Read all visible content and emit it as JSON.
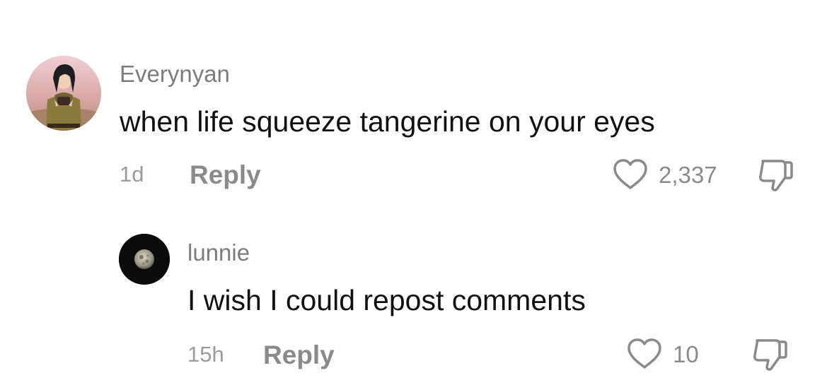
{
  "comments": [
    {
      "username": "Everynyan",
      "text": "when life squeeze tangerine on your eyes",
      "time": "1d",
      "reply_label": "Reply",
      "likes": "2,337",
      "avatar_icon": "anime-character-avatar"
    }
  ],
  "replies": [
    {
      "username": "lunnie",
      "text": "I wish I could repost comments",
      "time": "15h",
      "reply_label": "Reply",
      "likes": "10",
      "avatar_icon": "moon-avatar"
    }
  ],
  "icons": {
    "like": "heart-outline-icon",
    "dislike": "thumbs-down-outline-icon"
  },
  "colors": {
    "username": "#7c7c7c",
    "text": "#111111",
    "meta": "#8a8a8a"
  }
}
